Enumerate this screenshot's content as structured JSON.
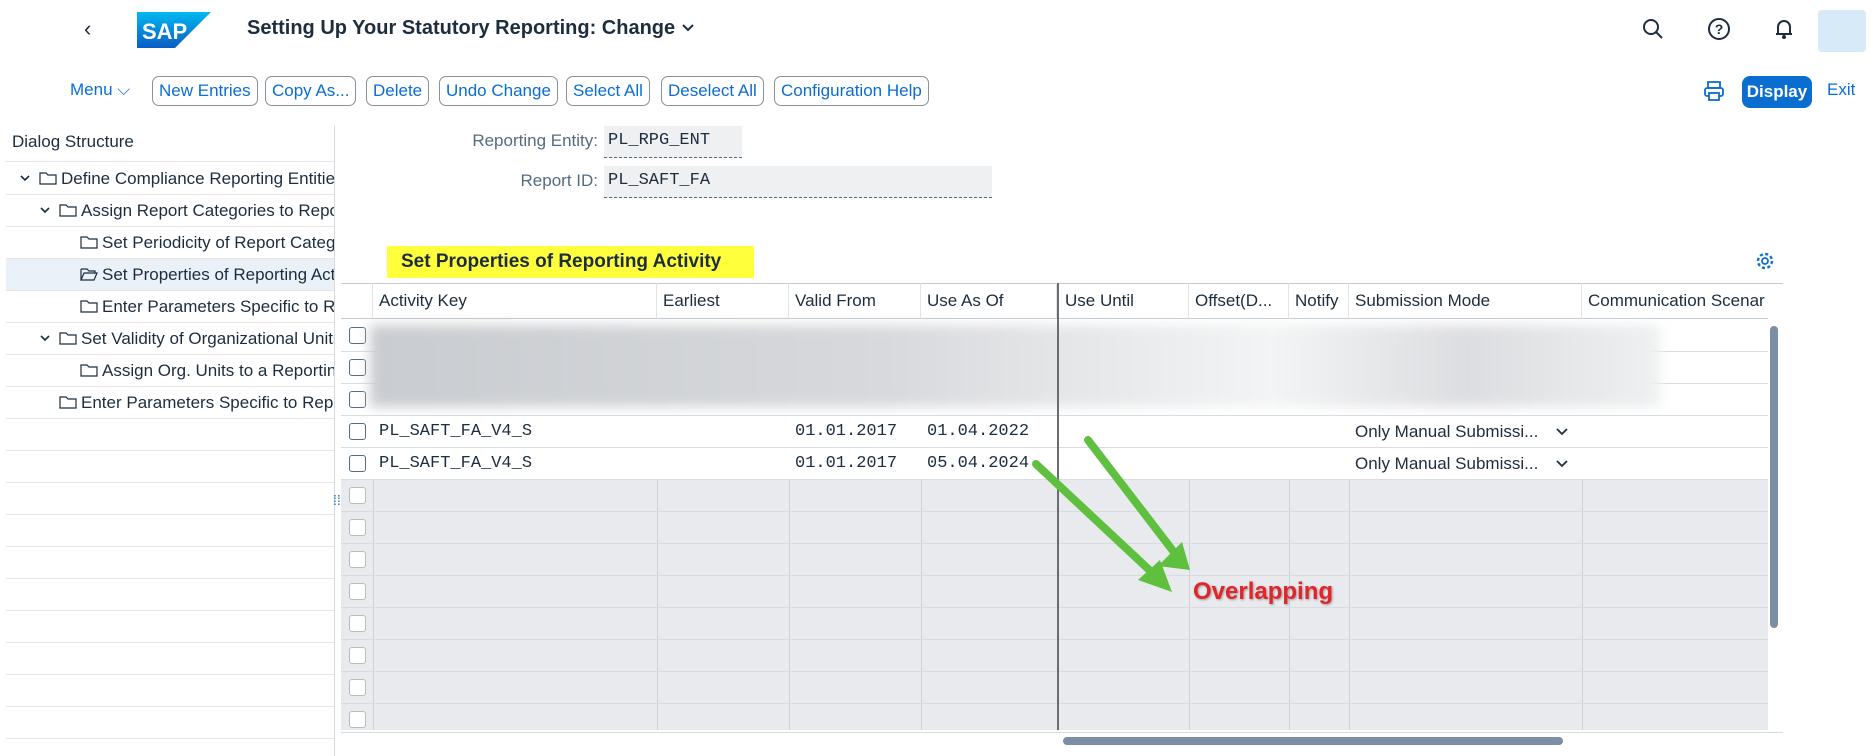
{
  "shell": {
    "title": "Setting Up Your Statutory Reporting: Change",
    "logo_text": "SAP"
  },
  "toolbar": {
    "menu": "Menu",
    "buttons": [
      "New Entries",
      "Copy As...",
      "Delete",
      "Undo Change",
      "Select All",
      "Deselect All",
      "Configuration Help"
    ],
    "display": "Display",
    "exit": "Exit"
  },
  "dialog": {
    "heading": "Dialog Structure",
    "items": [
      {
        "label": "Define Compliance Reporting Entities",
        "expanded": true
      },
      {
        "label": "Assign Report Categories to Reporting Entities",
        "expanded": true
      },
      {
        "label": "Set Periodicity of Report Categories"
      },
      {
        "label": "Set Properties of Reporting Activity",
        "selected": true
      },
      {
        "label": "Enter Parameters Specific to Report"
      },
      {
        "label": "Set Validity of Organizational Units",
        "expanded": true
      },
      {
        "label": "Assign Org. Units to a Reporting Entity"
      },
      {
        "label": "Enter Parameters Specific to Reporting Entity"
      }
    ]
  },
  "form": {
    "entity_label": "Reporting Entity:",
    "entity_value": "PL_RPG_ENT",
    "report_label": "Report ID:",
    "report_value": "PL_SAFT_FA"
  },
  "section": {
    "title": "Set Properties of Reporting Activity"
  },
  "table": {
    "columns": [
      "Activity Key",
      "Earliest",
      "Valid From",
      "Use As Of",
      "Use Until",
      "Offset(D...",
      "Notify",
      "Submission Mode",
      "Communication Scenar"
    ],
    "rows": [
      {
        "key": "PL_SAFT_FA_V4_S",
        "earliest": "",
        "valid_from": "01.01.2017",
        "use_as_of": "01.04.2022",
        "use_until": "",
        "offset": "",
        "notify": "",
        "submission": "Only Manual Submissi...",
        "comm": ""
      },
      {
        "key": "PL_SAFT_FA_V4_S",
        "earliest": "",
        "valid_from": "01.01.2017",
        "use_as_of": "05.04.2024",
        "use_until": "",
        "offset": "",
        "notify": "",
        "submission": "Only Manual Submissi...",
        "comm": ""
      }
    ]
  },
  "annotation": {
    "text": "Overlapping",
    "color": "#e2252b",
    "arrow_color": "#5fbf3f"
  },
  "colors": {
    "accent": "#0a6ed1",
    "highlight": "#ffff3c"
  }
}
